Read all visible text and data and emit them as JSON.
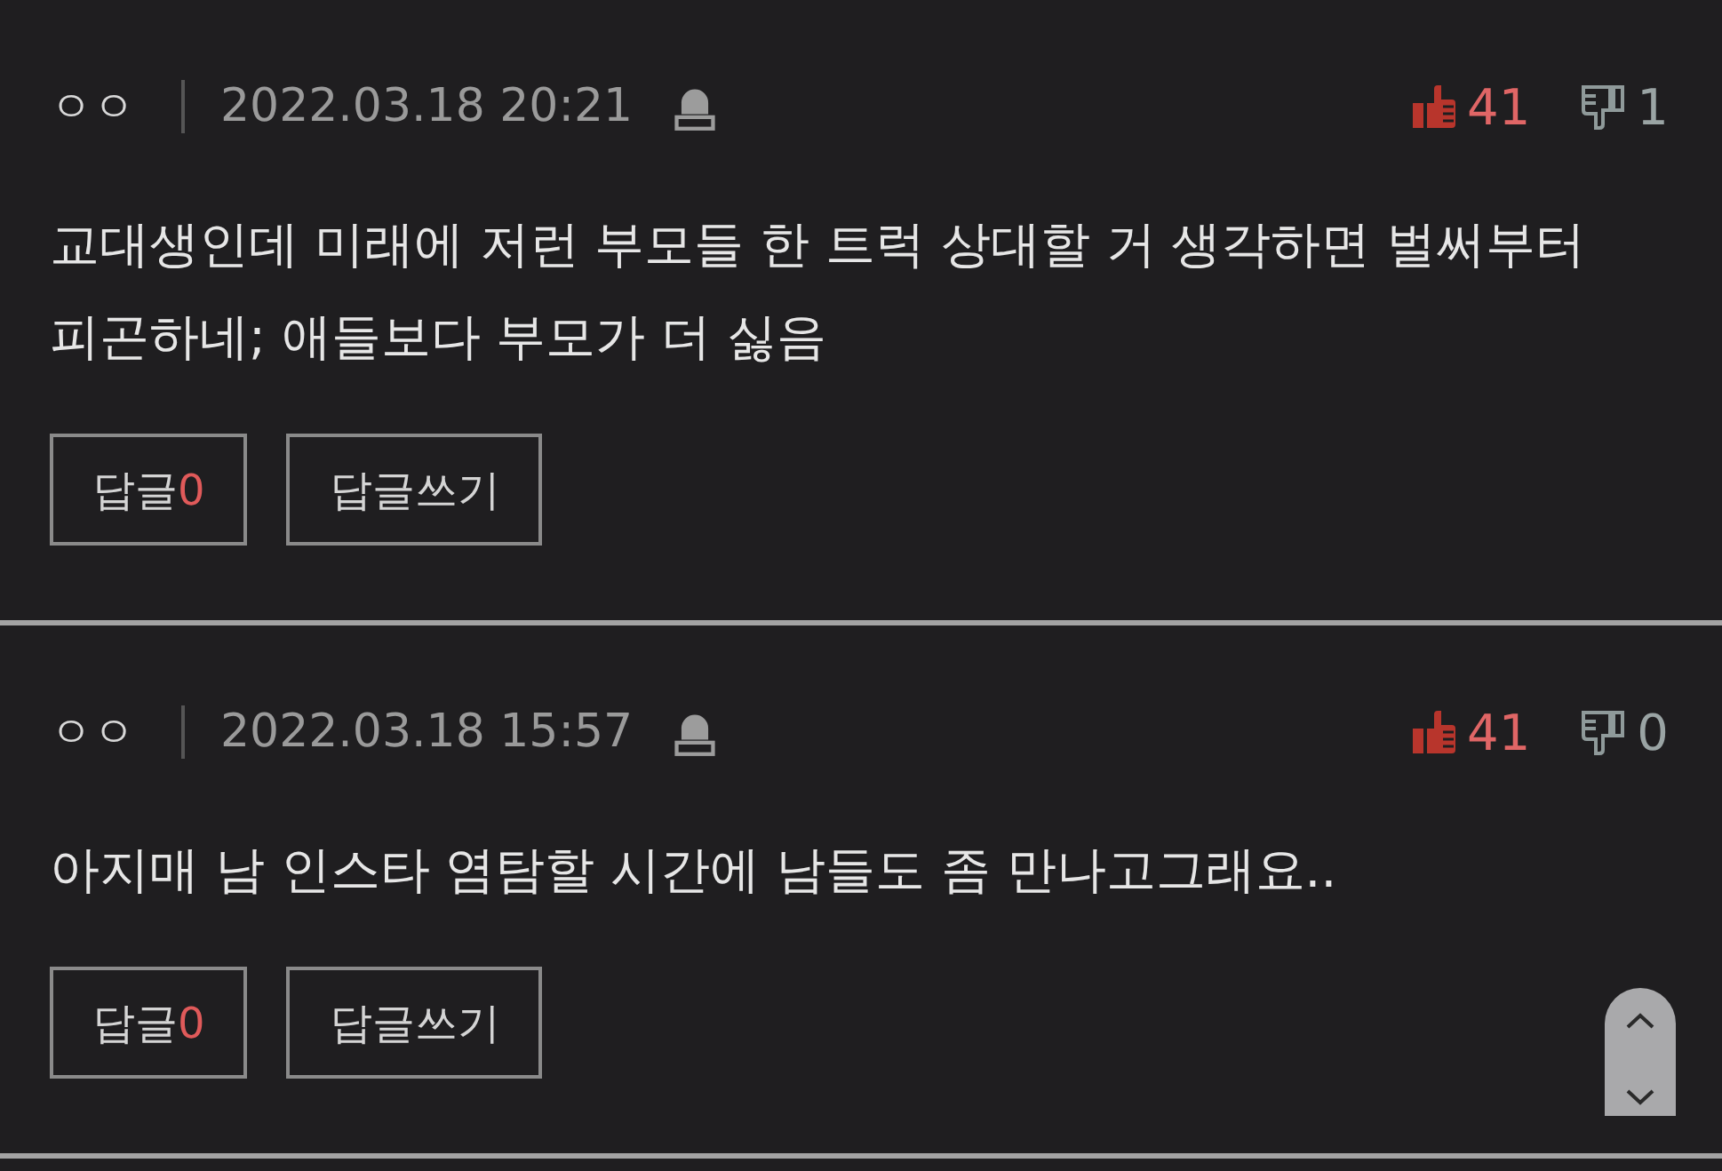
{
  "comments": [
    {
      "author": "ㅇㅇ",
      "date": "2022.03.18 20:21",
      "likes": "41",
      "dislikes": "1",
      "text": "교대생인데 미래에 저런 부모들 한 트럭 상대할 거 생각하면 벌써부터 피곤하네; 애들보다 부모가 더 싫음",
      "buttons": [
        {
          "kind": "reply_count",
          "label": "답글",
          "count": "0"
        },
        {
          "kind": "write_reply",
          "label": "답글쓰기"
        }
      ]
    },
    {
      "author": "ㅇㅇ",
      "date": "2022.03.18 15:57",
      "likes": "41",
      "dislikes": "0",
      "text": "아지매 남 인스타 염탐할 시간에 남들도 좀 만나고그래요..",
      "buttons": [
        {
          "kind": "reply_count",
          "label": "답글",
          "count": "0"
        },
        {
          "kind": "write_reply",
          "label": "답글쓰기"
        }
      ]
    }
  ]
}
